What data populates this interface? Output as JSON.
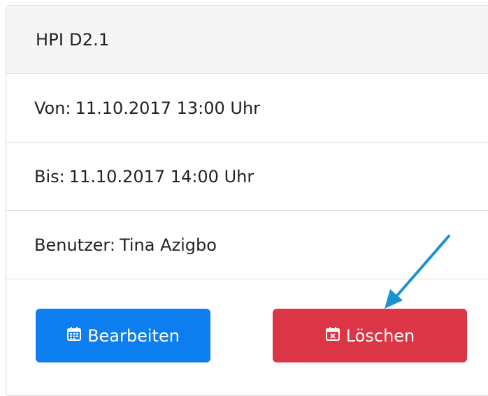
{
  "header": {
    "title": "HPI D2.1"
  },
  "details": {
    "from_label": "Von:",
    "from_value": "11.10.2017 13:00 Uhr",
    "to_label": "Bis:",
    "to_value": "11.10.2017 14:00 Uhr",
    "user_label": "Benutzer:",
    "user_value": "Tina Azigbo"
  },
  "actions": {
    "edit_label": "Bearbeiten",
    "delete_label": "Löschen",
    "edit_icon": "calendar-icon",
    "delete_icon": "calendar-x-icon",
    "edit_color": "#0d7ef0",
    "delete_color": "#dc3545"
  },
  "annotation": {
    "arrow_color": "#1c93d1"
  }
}
